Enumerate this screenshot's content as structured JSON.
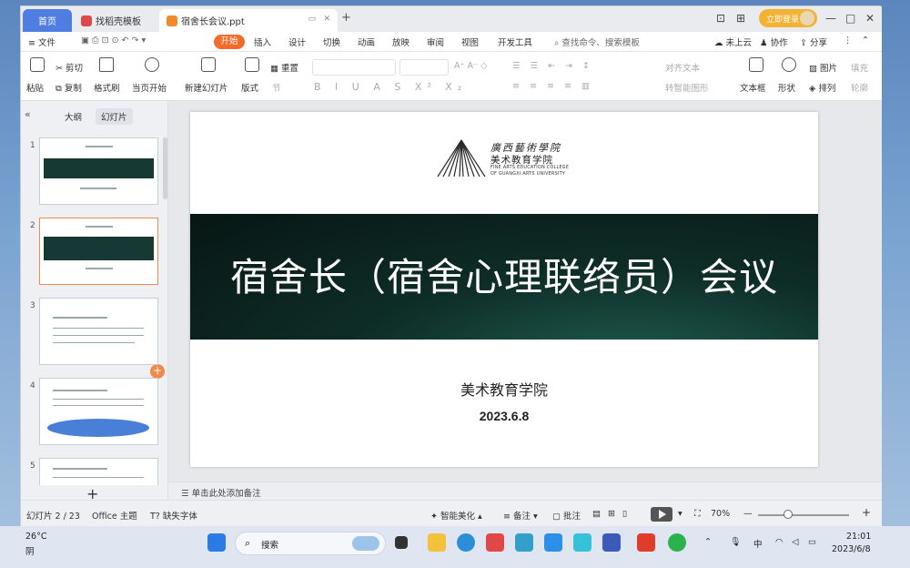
{
  "tabs": {
    "home": "首页",
    "templates": "找稻壳模板",
    "document": "宿舍长会议.ppt"
  },
  "window_controls": {
    "layout": "⊡",
    "grid": "⊞",
    "minimize": "—",
    "maximize": "□",
    "close": "✕"
  },
  "login": "立即登录",
  "menu": {
    "file": "≡ 文件",
    "items": [
      "开始",
      "插入",
      "设计",
      "切换",
      "动画",
      "放映",
      "审阅",
      "视图",
      "开发工具"
    ],
    "search_placeholder": "查找命令、搜索模板",
    "cloud": "未上云",
    "collab": "协作",
    "share": "分享"
  },
  "ribbon": {
    "paste": "粘贴",
    "cut": "剪切",
    "copy": "复制",
    "format_painter": "格式刷",
    "from_current": "当页开始",
    "new_slide": "新建幻灯片",
    "layout": "版式",
    "section": "节",
    "reset": "重置",
    "align_text": "对齐文本",
    "smart_graphic": "转智能图形",
    "textbox": "文本框",
    "shape": "形状",
    "picture": "图片",
    "arrange": "排列",
    "fill": "填充",
    "outline": "轮廓"
  },
  "panel": {
    "outline_tab": "大纲",
    "slides_tab": "幻灯片"
  },
  "thumbnails": [
    "1",
    "2",
    "3",
    "4",
    "5"
  ],
  "slide": {
    "logo_cn": "廣西藝術學院",
    "logo_sub": "美术教育学院",
    "logo_en1": "FINE ARTS EDUCATION COLLEGE",
    "logo_en2": "OF GUANGXI ARTS UNIVERSITY",
    "title": "宿舍长（宿舍心理联络员）会议",
    "org": "美术教育学院",
    "date": "2023.6.8"
  },
  "notes_placeholder": "单击此处添加备注",
  "status": {
    "slide_count": "幻灯片 2 / 23",
    "theme": "Office 主题",
    "missing_font": "缺失字体",
    "beautify": "智能美化",
    "notes": "备注",
    "comments": "批注",
    "zoom": "70%"
  },
  "taskbar": {
    "weather_temp": "26°C",
    "weather_desc": "阴",
    "search": "搜索",
    "ime": "中",
    "time": "21:01",
    "date": "2023/6/8"
  },
  "colors": {
    "accent": "#f16c2b",
    "home_tab": "#4f7ee0",
    "band": "#0e2d27",
    "login": "#f2b233"
  }
}
